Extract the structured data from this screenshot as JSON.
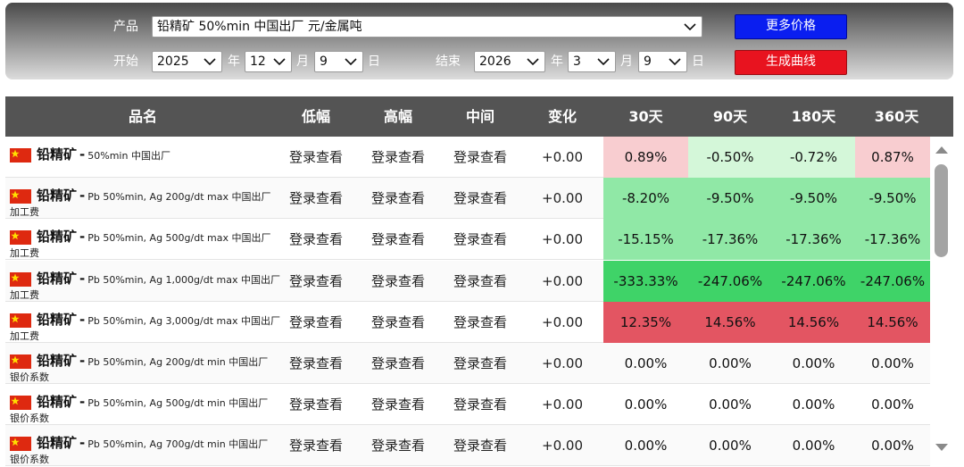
{
  "filters": {
    "product_label": "产品",
    "product_value": "铅精矿 50%min 中国出厂 元/金属吨",
    "start_label": "开始",
    "start_year": "2025",
    "start_month": "12",
    "start_day": "9",
    "end_label": "结束",
    "end_year": "2026",
    "end_month": "3",
    "end_day": "9",
    "year_unit": "年",
    "month_unit": "月",
    "day_unit": "日",
    "more_prices_button": "更多价格",
    "generate_curve_button": "生成曲线"
  },
  "colors": {
    "light_red": "#f8cdd0",
    "light_green": "#d4f7d9",
    "green": "#90e8a6",
    "dark_green": "#3fd368",
    "red": "#e35562"
  },
  "table": {
    "headers": [
      "品名",
      "低幅",
      "高幅",
      "中间",
      "变化",
      "30天",
      "90天",
      "180天",
      "360天"
    ],
    "rows": [
      {
        "name": "铅精矿",
        "spec": "50%min 中国出厂",
        "line2": "",
        "low": "登录查看",
        "high": "登录查看",
        "mid": "登录查看",
        "change": "+0.00",
        "d30": "0.89%",
        "d90": "-0.50%",
        "d180": "-0.72%",
        "d360": "0.87%",
        "bg": [
          "#f8cdd0",
          "#d4f7d9",
          "#d4f7d9",
          "#f8cdd0"
        ]
      },
      {
        "name": "铅精矿",
        "spec": "Pb 50%min, Ag 200g/dt max 中国出厂",
        "line2": "加工费",
        "low": "登录查看",
        "high": "登录查看",
        "mid": "登录查看",
        "change": "+0.00",
        "d30": "-8.20%",
        "d90": "-9.50%",
        "d180": "-9.50%",
        "d360": "-9.50%",
        "bg": [
          "#90e8a6",
          "#90e8a6",
          "#90e8a6",
          "#90e8a6"
        ]
      },
      {
        "name": "铅精矿",
        "spec": "Pb 50%min, Ag 500g/dt max 中国出厂",
        "line2": "加工费",
        "low": "登录查看",
        "high": "登录查看",
        "mid": "登录查看",
        "change": "+0.00",
        "d30": "-15.15%",
        "d90": "-17.36%",
        "d180": "-17.36%",
        "d360": "-17.36%",
        "bg": [
          "#90e8a6",
          "#90e8a6",
          "#90e8a6",
          "#90e8a6"
        ]
      },
      {
        "name": "铅精矿",
        "spec": "Pb 50%min, Ag 1,000g/dt max 中国出厂",
        "line2": "加工费",
        "low": "登录查看",
        "high": "登录查看",
        "mid": "登录查看",
        "change": "+0.00",
        "d30": "-333.33%",
        "d90": "-247.06%",
        "d180": "-247.06%",
        "d360": "-247.06%",
        "bg": [
          "#3fd368",
          "#3fd368",
          "#3fd368",
          "#3fd368"
        ]
      },
      {
        "name": "铅精矿",
        "spec": "Pb 50%min, Ag 3,000g/dt max 中国出厂",
        "line2": "加工费",
        "low": "登录查看",
        "high": "登录查看",
        "mid": "登录查看",
        "change": "+0.00",
        "d30": "12.35%",
        "d90": "14.56%",
        "d180": "14.56%",
        "d360": "14.56%",
        "bg": [
          "#e35562",
          "#e35562",
          "#e35562",
          "#e35562"
        ]
      },
      {
        "name": "铅精矿",
        "spec": "Pb 50%min, Ag 200g/dt min 中国出厂",
        "line2": "银价系数",
        "low": "登录查看",
        "high": "登录查看",
        "mid": "登录查看",
        "change": "+0.00",
        "d30": "0.00%",
        "d90": "0.00%",
        "d180": "0.00%",
        "d360": "0.00%",
        "bg": [
          "",
          "",
          "",
          ""
        ]
      },
      {
        "name": "铅精矿",
        "spec": "Pb 50%min, Ag 500g/dt min 中国出厂",
        "line2": "银价系数",
        "low": "登录查看",
        "high": "登录查看",
        "mid": "登录查看",
        "change": "+0.00",
        "d30": "0.00%",
        "d90": "0.00%",
        "d180": "0.00%",
        "d360": "0.00%",
        "bg": [
          "",
          "",
          "",
          ""
        ]
      },
      {
        "name": "铅精矿",
        "spec": "Pb 50%min, Ag 700g/dt min 中国出厂",
        "line2": "银价系数",
        "low": "登录查看",
        "high": "登录查看",
        "mid": "登录查看",
        "change": "+0.00",
        "d30": "0.00%",
        "d90": "0.00%",
        "d180": "0.00%",
        "d360": "0.00%",
        "bg": [
          "",
          "",
          "",
          ""
        ]
      }
    ]
  },
  "icons": {
    "dropdown": "chevron-down-icon",
    "flag": "china-flag-icon",
    "scroll_up": "scroll-up-arrow-icon",
    "scroll_down": "scroll-down-arrow-icon"
  }
}
